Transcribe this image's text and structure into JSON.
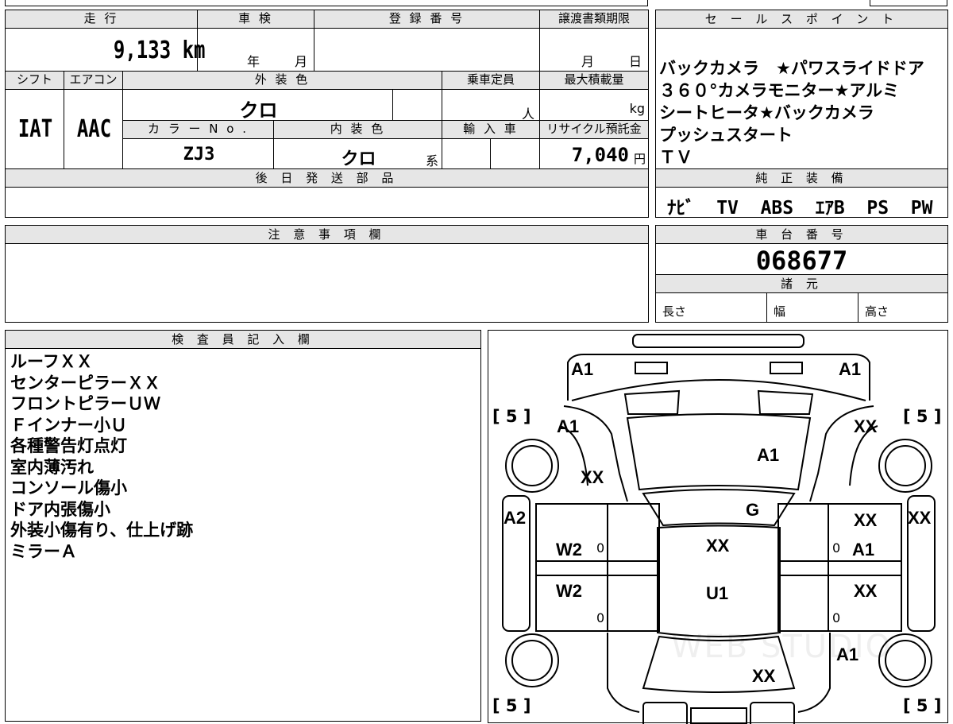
{
  "summary": {
    "mileage_label": "走 行",
    "mileage_value": "9,133 km",
    "inspection_label": "車 検",
    "inspection_year": "年",
    "inspection_month": "月",
    "registration_label": "登 録 番 号",
    "transfer_label": "譲渡書類期限",
    "transfer_month": "月",
    "transfer_day": "日",
    "shift_label": "シフト",
    "shift_value": "IAT",
    "ac_label": "エアコン",
    "ac_value": "AAC",
    "exterior_label": "外 装 色",
    "exterior_value": "クロ",
    "capacity_label": "乗車定員",
    "capacity_unit": "人",
    "maxload_label": "最大積載量",
    "maxload_unit": "kg",
    "color_no_label": "カ ラ ー N o .",
    "color_no_value": "ZJ3",
    "interior_label": "内 装 色",
    "interior_value": "クロ",
    "interior_suffix": "系",
    "import_label": "輸 入 車",
    "recycle_label": "リサイクル預託金",
    "recycle_value": "7,040",
    "recycle_unit": "円"
  },
  "later_parts": {
    "label": "後 日 発 送 部 品"
  },
  "notes": {
    "label": "注 意 事 項 欄"
  },
  "sales_points": {
    "label": "セ ー ル ス ポ イ ン ト",
    "lines": [
      "バックカメラ　★パワスライドドア",
      "３６０°カメラモニター★アルミ",
      "シートヒータ★バックカメラ",
      "プッシュスタート",
      "ＴＶ"
    ]
  },
  "equipment": {
    "label": "純 正 装 備",
    "value": "ﾅﾋﾞ  TV  ABS  ｴｱB  PS  PW"
  },
  "chassis": {
    "label": "車 台 番 号",
    "value": "068677"
  },
  "specs": {
    "label": "諸 元",
    "length": "長さ",
    "width": "幅",
    "height": "高さ"
  },
  "inspector": {
    "label": "検 査 員 記 入 欄",
    "lines": [
      "ルーフＸＸ",
      "センターピラーＸＸ",
      "フロントピラーＵＷ",
      "Ｆインナー小Ｕ",
      "各種警告灯点灯",
      "室内薄汚れ",
      "コンソール傷小",
      "ドア内張傷小",
      "外装小傷有り、仕上げ跡",
      "ミラーＡ"
    ]
  },
  "diagram": {
    "tires": [
      "[ 5 ]",
      "[ 5 ]",
      "[ 5 ]",
      "[ 5 ]"
    ],
    "grades": {
      "front_left_corner": "A1",
      "front_right_corner": "A1",
      "left_fender": "A1",
      "right_fender": "XX",
      "hood": "A1",
      "left_fender_lower": "XX",
      "windshield": "G",
      "left_rocker": "A2",
      "right_rocker": "XX",
      "front_left_door": "W2",
      "front_left_door_num": "0",
      "front_right_door_top": "XX",
      "front_right_door": "A1",
      "front_right_door_num": "0",
      "roof": "XX",
      "roof_lower": "U1",
      "rear_left_door": "W2",
      "rear_left_door_num": "0",
      "rear_right_door": "XX",
      "rear_right_door_num": "0",
      "right_quarter": "A1",
      "trunk": "XX"
    },
    "watermark": "WEB STUDIO"
  }
}
